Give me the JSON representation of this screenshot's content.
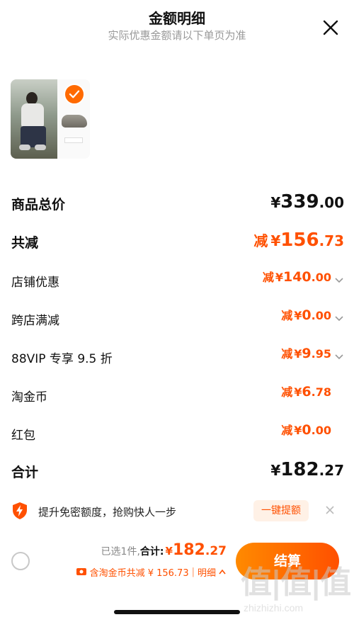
{
  "header": {
    "title": "金额明细",
    "subtitle": "实际优惠金额请以下单页为准"
  },
  "rows": [
    {
      "label": "商品总价",
      "minus": "",
      "currency": "¥",
      "int": "339",
      "dec": ".00"
    },
    {
      "label": "共减",
      "minus": "减",
      "currency": "¥",
      "int": "156",
      "dec": ".73"
    },
    {
      "label": "店铺优惠",
      "minus": "减",
      "currency": "¥",
      "int": "140",
      "dec": ".00"
    },
    {
      "label": "跨店满减",
      "minus": "减",
      "currency": "¥",
      "int": "0",
      "dec": ".00"
    },
    {
      "label": "88VIP 专享 9.5 折",
      "minus": "减",
      "currency": "¥",
      "int": "9",
      "dec": ".95"
    },
    {
      "label": "淘金币",
      "minus": "减",
      "currency": "¥",
      "int": "6",
      "dec": ".78"
    },
    {
      "label": "红包",
      "minus": "减",
      "currency": "¥",
      "int": "0",
      "dec": ".00"
    },
    {
      "label": "合计",
      "minus": "",
      "currency": "¥",
      "int": "182",
      "dec": ".27"
    }
  ],
  "promo": {
    "text": "提升免密额度，抢购快人一步",
    "button": "一键提额"
  },
  "footer": {
    "selected": "已选1件,",
    "total_label": "合计:",
    "currency": "¥",
    "total_int": "182",
    "total_dec": ".27",
    "coin_text": "含淘金币共减 ¥ 156.73",
    "separator": "|",
    "detail_label": "明细",
    "checkout_label": "结算"
  },
  "watermark": {
    "glyphs": "值|值|值",
    "url": "zhizhizhi.com"
  },
  "colors": {
    "accent": "#ff5000",
    "checkout_start": "#ff8a00",
    "checkout_end": "#ff5000",
    "muted": "#999999"
  },
  "icons": {
    "close": "close-icon",
    "check": "check-icon",
    "chevron": "chevron-down-icon",
    "shield": "shield-lightning-icon",
    "coin": "coin-ticket-icon",
    "chevron_up": "chevron-up-icon"
  }
}
